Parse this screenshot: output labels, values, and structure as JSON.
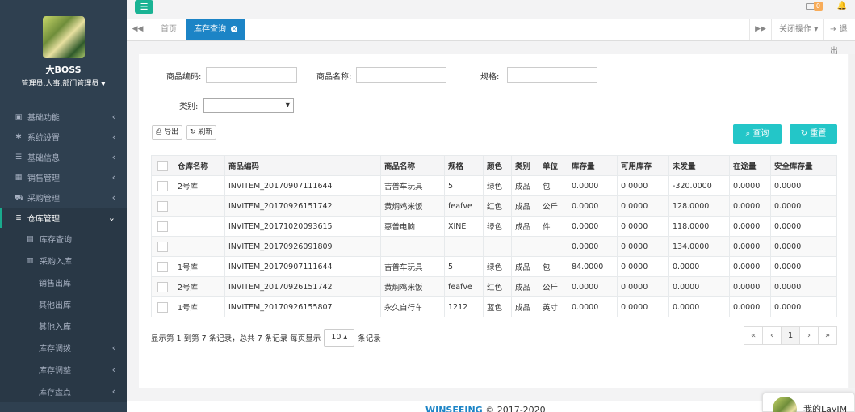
{
  "sidebar": {
    "profile": {
      "name": "大BOSS",
      "role": "管理员,人事,部门管理员"
    },
    "menu": [
      {
        "label": "基础功能",
        "icon": "calendar-icon"
      },
      {
        "label": "系统设置",
        "icon": "gear-icon"
      },
      {
        "label": "基础信息",
        "icon": "list-icon"
      },
      {
        "label": "销售管理",
        "icon": "table-icon"
      },
      {
        "label": "采购管理",
        "icon": "cart-icon"
      },
      {
        "label": "仓库管理",
        "icon": "database-icon",
        "expanded": true
      }
    ],
    "submenu": [
      {
        "label": "库存查询",
        "icon": "doc-icon"
      },
      {
        "label": "采购入库",
        "icon": "calc-icon"
      },
      {
        "label": "销售出库"
      },
      {
        "label": "其他出库"
      },
      {
        "label": "其他入库"
      },
      {
        "label": "库存调拨",
        "has_children": true
      },
      {
        "label": "库存调整",
        "has_children": true
      },
      {
        "label": "库存盘点",
        "has_children": true
      }
    ]
  },
  "header": {
    "mail_badge": "0"
  },
  "tabs": {
    "home": "首页",
    "active": "库存查询",
    "close_ops": "关闭操作",
    "logout": "退出"
  },
  "search": {
    "code_label": "商品编码:",
    "name_label": "商品名称:",
    "spec_label": "规格:",
    "category_label": "类别:",
    "code_value": "",
    "name_value": "",
    "spec_value": "",
    "category_value": ""
  },
  "toolbar": {
    "export_label": "导出",
    "refresh_label": "刷新",
    "query_label": "查询",
    "reset_label": "重置"
  },
  "table": {
    "columns": [
      "仓库名称",
      "商品编码",
      "商品名称",
      "规格",
      "颜色",
      "类别",
      "单位",
      "库存量",
      "可用库存",
      "未发量",
      "在途量",
      "安全库存量"
    ],
    "rows": [
      [
        "2号库",
        "INVITEM_20170907111644",
        "吉普车玩具",
        "5",
        "绿色",
        "成品",
        "包",
        "0.0000",
        "0.0000",
        "-320.0000",
        "0.0000",
        "0.0000"
      ],
      [
        "",
        "INVITEM_20170926151742",
        "黄焖鸡米饭",
        "feafve",
        "红色",
        "成品",
        "公斤",
        "0.0000",
        "0.0000",
        "128.0000",
        "0.0000",
        "0.0000"
      ],
      [
        "",
        "INVITEM_20171020093615",
        "惠普电脑",
        "XINE",
        "绿色",
        "成品",
        "件",
        "0.0000",
        "0.0000",
        "118.0000",
        "0.0000",
        "0.0000"
      ],
      [
        "",
        "INVITEM_20170926091809",
        "",
        "",
        "",
        "",
        "",
        "0.0000",
        "0.0000",
        "134.0000",
        "0.0000",
        "0.0000"
      ],
      [
        "1号库",
        "INVITEM_20170907111644",
        "吉普车玩具",
        "5",
        "绿色",
        "成品",
        "包",
        "84.0000",
        "0.0000",
        "0.0000",
        "0.0000",
        "0.0000"
      ],
      [
        "2号库",
        "INVITEM_20170926151742",
        "黄焖鸡米饭",
        "feafve",
        "红色",
        "成品",
        "公斤",
        "0.0000",
        "0.0000",
        "0.0000",
        "0.0000",
        "0.0000"
      ],
      [
        "1号库",
        "INVITEM_20170926155807",
        "永久自行车",
        "1212",
        "蓝色",
        "成品",
        "英寸",
        "0.0000",
        "0.0000",
        "0.0000",
        "0.0000",
        "0.0000"
      ]
    ]
  },
  "pagination": {
    "summary": "显示第 1 到第 7 条记录，总共 7 条记录 每页显示",
    "page_size": "10",
    "suffix": "条记录",
    "first": "«",
    "prev": "‹",
    "current": "1",
    "next": "›",
    "last": "»"
  },
  "footer": {
    "brand": "WINSEEING",
    "copyright": "© 2017-2020"
  },
  "chat": {
    "name": "我的LayIM"
  },
  "colors": {
    "sidebar": "#2f4050",
    "accent": "#1ab394",
    "tab_active": "#1c84c6",
    "button": "#23c6c8",
    "badge": "#f8ac59"
  }
}
